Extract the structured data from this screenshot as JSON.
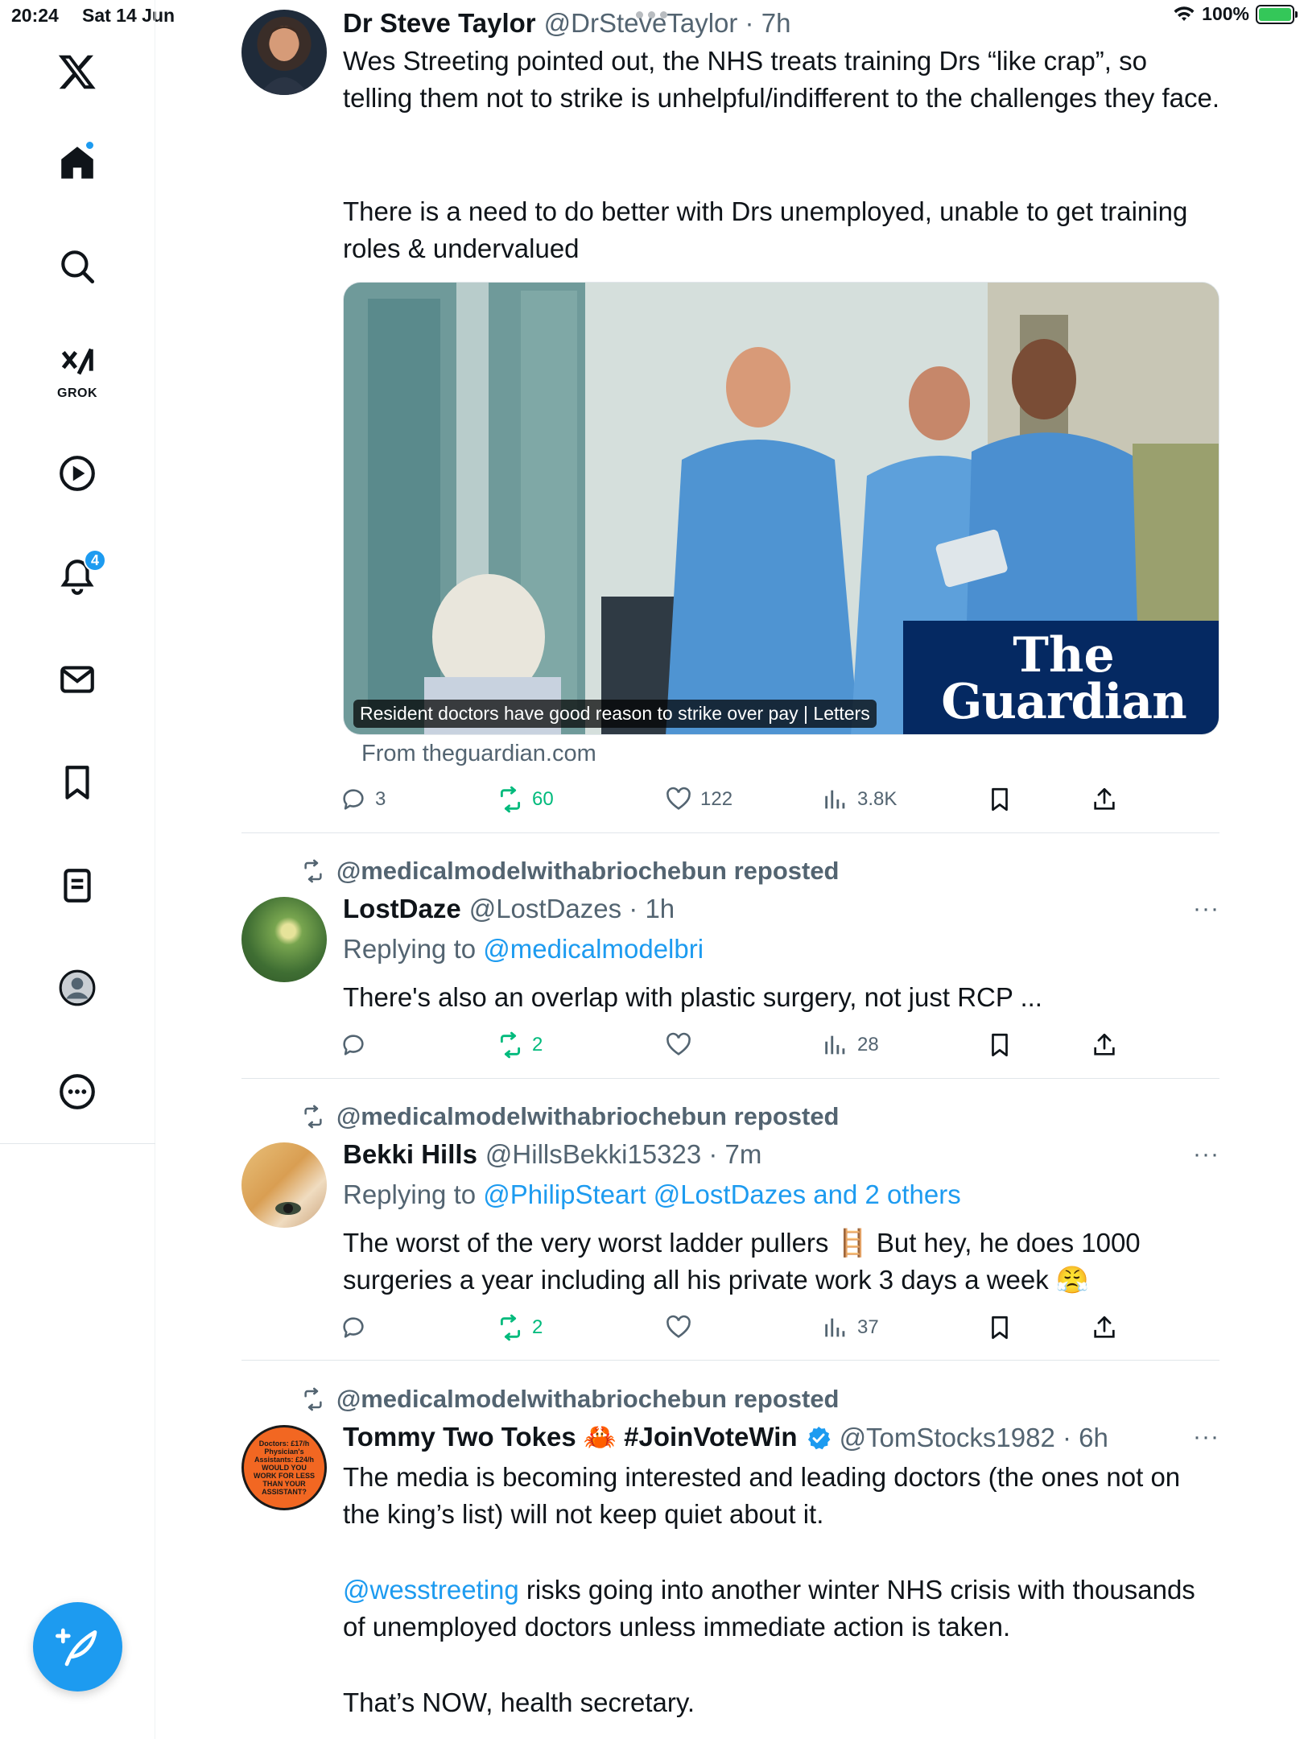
{
  "status_bar": {
    "time": "20:24",
    "date": "Sat 14 Jun",
    "battery": "100%"
  },
  "sidebar": {
    "items": [
      {
        "name": "x-logo"
      },
      {
        "name": "home"
      },
      {
        "name": "search"
      },
      {
        "name": "grok",
        "label": "GROK"
      },
      {
        "name": "video"
      },
      {
        "name": "notifications",
        "badge": "4"
      },
      {
        "name": "messages"
      },
      {
        "name": "bookmarks"
      },
      {
        "name": "articles"
      },
      {
        "name": "profile"
      },
      {
        "name": "more"
      }
    ]
  },
  "tweets": [
    {
      "name": "Dr Steve Taylor",
      "handle": "@DrSteveTaylor · 7h",
      "text1": "Wes Streeting pointed out, the NHS treats training Drs “like crap”, so telling them not to strike is unhelpful/indifferent to the challenges they face.",
      "text2": "There is a need to do better with Drs unemployed, unable to get training roles & undervalued",
      "card": {
        "caption": "Resident doctors have good reason to strike over pay | Letters",
        "publisher_line1": "The",
        "publisher_line2": "Guardian",
        "from": "From theguardian.com"
      },
      "stats": {
        "replies": "3",
        "reposts": "60",
        "likes": "122",
        "views": "3.8K"
      }
    },
    {
      "repost_label": "@medicalmodelwithabriochebun reposted",
      "name": "LostDaze",
      "handle": "@LostDazes · 1h",
      "replying_prefix": "Replying to",
      "replying_to": "@medicalmodelbri",
      "text": "There's also an overlap with plastic surgery, not just RCP ...",
      "stats": {
        "replies": "",
        "reposts": "2",
        "likes": "",
        "views": "28"
      }
    },
    {
      "repost_label": "@medicalmodelwithabriochebun reposted",
      "name": "Bekki Hills",
      "handle": "@HillsBekki15323 · 7m",
      "replying_prefix": "Replying to",
      "replying_to": "@PhilipSteart @LostDazes and 2 others",
      "text": "The worst of the very worst ladder pullers 🪜 But hey, he does 1000 surgeries a year including all his private work 3 days a week 😤",
      "stats": {
        "replies": "",
        "reposts": "2",
        "likes": "",
        "views": "37"
      }
    },
    {
      "repost_label": "@medicalmodelwithabriochebun reposted",
      "name": "Tommy Two Tokes 🦀 #JoinVoteWin",
      "handle": "@TomStocks1982 · 6h",
      "avatar_text": "Doctors: £17/h Physician's Assistants: £24/h WOULD YOU WORK FOR LESS THAN YOUR ASSISTANT?",
      "text1": "The media is becoming interested and leading doctors (the ones not on the king’s list) will not keep quiet about it.",
      "text2_mention": "@wesstreeting",
      "text2_rest": " risks going into another winter NHS crisis with thousands of unemployed doctors unless immediate action is taken.",
      "text3": "That’s NOW, health secretary."
    }
  ],
  "colors": {
    "accent": "#1d9bf0",
    "repost_green": "#00ba7c",
    "muted": "#536471",
    "guardian_blue": "#052962"
  }
}
